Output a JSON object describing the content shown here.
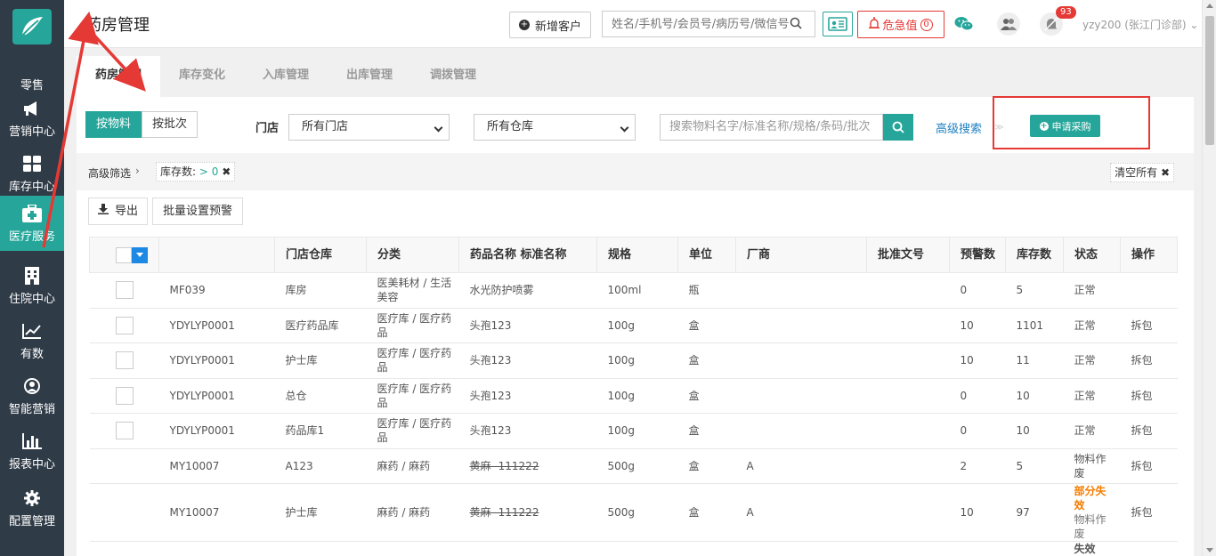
{
  "sidebar": {
    "items": [
      {
        "label": "零售",
        "icon": "shopping-cart-icon"
      },
      {
        "label": "营销中心",
        "icon": "megaphone-icon"
      },
      {
        "label": "库存中心",
        "icon": "grid-icon"
      },
      {
        "label": "医疗服务",
        "icon": "medical-kit-icon",
        "active": true
      },
      {
        "label": "住院中心",
        "icon": "hospital-icon"
      },
      {
        "label": "有数",
        "icon": "trend-chart-icon"
      },
      {
        "label": "智能营销",
        "icon": "smart-target-icon"
      },
      {
        "label": "报表中心",
        "icon": "bar-chart-icon"
      },
      {
        "label": "配置管理",
        "icon": "gear-icon"
      }
    ]
  },
  "header": {
    "title": "药房管理",
    "new_customer": "新增客户",
    "search_placeholder": "姓名/手机号/会员号/病历号/微信号",
    "critical_label": "危急值",
    "critical_count": "0",
    "notify_count": "93",
    "user": "yzy200 (张江门诊部)"
  },
  "tabs": [
    "药房管理",
    "库存变化",
    "入库管理",
    "出库管理",
    "调拨管理"
  ],
  "toolbar": {
    "by_material": "按物料",
    "by_batch": "按批次",
    "store_label": "门店",
    "store_select": "所有门店",
    "warehouse_select": "所有仓库",
    "search_placeholder": "搜索物料名字/标准名称/规格/条码/批次",
    "advanced": "高级搜索",
    "apply_purchase": "申请采购"
  },
  "filters": {
    "label": "高级筛选",
    "tag_name": "库存数:",
    "tag_value": "> 0",
    "clear_all": "清空所有"
  },
  "actions": {
    "export": "导出",
    "batch_warning": "批量设置预警"
  },
  "table": {
    "columns": [
      "",
      "",
      "门店仓库",
      "分类",
      "药品名称 标准名称",
      "规格",
      "单位",
      "厂商",
      "批准文号",
      "预警数",
      "库存数",
      "状态",
      "操作"
    ],
    "rows": [
      {
        "code": "MF039",
        "warehouse": "库房",
        "category": "医美耗材 / 生活美容",
        "name": "水光防护喷雾",
        "spec": "100ml",
        "unit": "瓶",
        "maker": "",
        "approval": "",
        "warn": "0",
        "stock": "5",
        "status": "正常",
        "op": ""
      },
      {
        "code": "YDYLYP0001",
        "warehouse": "医疗药品库",
        "category": "医疗库 / 医疗药品",
        "name": "头孢123",
        "spec": "100g",
        "unit": "盒",
        "maker": "",
        "approval": "",
        "warn": "10",
        "stock": "1101",
        "status": "正常",
        "op": "拆包"
      },
      {
        "code": "YDYLYP0001",
        "warehouse": "护士库",
        "category": "医疗库 / 医疗药品",
        "name": "头孢123",
        "spec": "100g",
        "unit": "盒",
        "maker": "",
        "approval": "",
        "warn": "10",
        "stock": "11",
        "status": "正常",
        "op": "拆包"
      },
      {
        "code": "YDYLYP0001",
        "warehouse": "总仓",
        "category": "医疗库 / 医疗药品",
        "name": "头孢123",
        "spec": "100g",
        "unit": "盒",
        "maker": "",
        "approval": "",
        "warn": "0",
        "stock": "10",
        "status": "正常",
        "op": "拆包"
      },
      {
        "code": "YDYLYP0001",
        "warehouse": "药品库1",
        "category": "医疗库 / 医疗药品",
        "name": "头孢123",
        "spec": "100g",
        "unit": "盒",
        "maker": "",
        "approval": "",
        "warn": "0",
        "stock": "10",
        "status": "正常",
        "op": "拆包"
      },
      {
        "code": "MY10007",
        "warehouse": "A123",
        "category": "麻药 / 麻药",
        "name": "黄麻- 111222",
        "spec": "500g",
        "unit": "盒",
        "maker": "A",
        "approval": "",
        "warn": "2",
        "stock": "5",
        "status": "物料作废",
        "op": "拆包"
      },
      {
        "code": "MY10007",
        "warehouse": "护士库",
        "category": "麻药 / 麻药",
        "name": "黄麻- 111222",
        "spec": "500g",
        "unit": "盒",
        "maker": "A",
        "approval": "",
        "warn": "10",
        "stock": "97",
        "status_alert": "部分失效",
        "status": "物料作废",
        "op": "拆包"
      }
    ],
    "partial_row_status": "失效"
  },
  "colors": {
    "sidebar": "#2f3b47",
    "accent": "#26a69a",
    "link": "#1e7fc0",
    "alert_red": "#e53935",
    "warning_orange": "#f57c00"
  }
}
